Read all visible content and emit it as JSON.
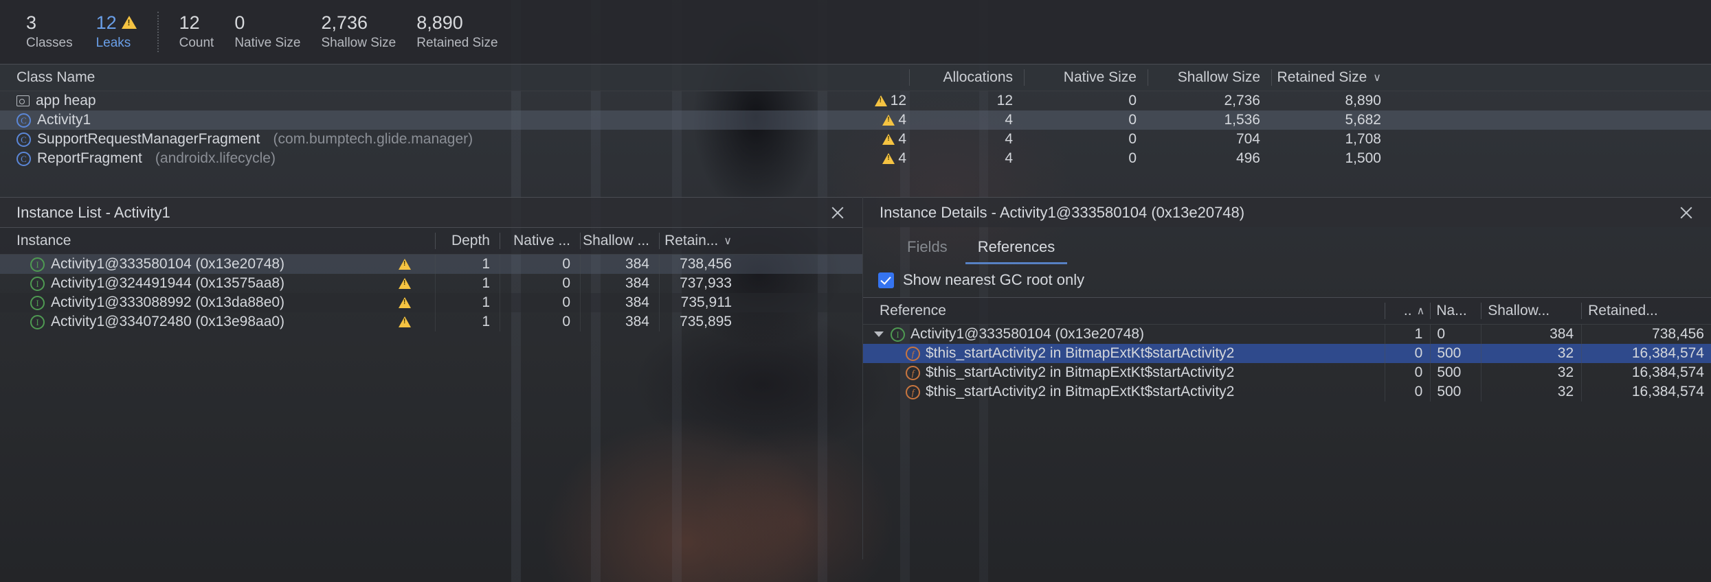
{
  "summary": {
    "stats": [
      {
        "value": "3",
        "label": "Classes",
        "warn": false
      },
      {
        "value": "12",
        "label": "Leaks",
        "warn": true
      },
      {
        "value": "12",
        "label": "Count",
        "warn": false
      },
      {
        "value": "0",
        "label": "Native Size",
        "warn": false
      },
      {
        "value": "2,736",
        "label": "Shallow Size",
        "warn": false
      },
      {
        "value": "8,890",
        "label": "Retained Size",
        "warn": false
      }
    ]
  },
  "class_table": {
    "headers": {
      "name": "Class Name",
      "leaks": "",
      "allocations": "Allocations",
      "native_size": "Native Size",
      "shallow_size": "Shallow Size",
      "retained_size": "Retained Size",
      "sort_chevron": "∨"
    },
    "rows": [
      {
        "icon": "heap-icon",
        "name": "app heap",
        "package": "",
        "leaks": "12",
        "allocations": "12",
        "native_size": "0",
        "shallow_size": "2,736",
        "retained_size": "8,890",
        "selected": false
      },
      {
        "icon": "class-icon",
        "name": "Activity1",
        "package": "",
        "leaks": "4",
        "allocations": "4",
        "native_size": "0",
        "shallow_size": "1,536",
        "retained_size": "5,682",
        "selected": true
      },
      {
        "icon": "class-icon",
        "name": "SupportRequestManagerFragment",
        "package": "(com.bumptech.glide.manager)",
        "leaks": "4",
        "allocations": "4",
        "native_size": "0",
        "shallow_size": "704",
        "retained_size": "1,708",
        "selected": false
      },
      {
        "icon": "class-icon",
        "name": "ReportFragment",
        "package": "(androidx.lifecycle)",
        "leaks": "4",
        "allocations": "4",
        "native_size": "0",
        "shallow_size": "496",
        "retained_size": "1,500",
        "selected": false
      }
    ]
  },
  "instance_list": {
    "title": "Instance List - Activity1",
    "close_label": "×",
    "headers": {
      "instance": "Instance",
      "depth": "Depth",
      "native": "Native ...",
      "shallow": "Shallow ...",
      "retained": "Retain...",
      "sort_chevron": "∨"
    },
    "rows": [
      {
        "name": "Activity1@333580104 (0x13e20748)",
        "warn": true,
        "depth": "1",
        "native": "0",
        "shallow": "384",
        "retained": "738,456",
        "selected": true
      },
      {
        "name": "Activity1@324491944 (0x13575aa8)",
        "warn": true,
        "depth": "1",
        "native": "0",
        "shallow": "384",
        "retained": "737,933",
        "selected": false
      },
      {
        "name": "Activity1@333088992 (0x13da88e0)",
        "warn": true,
        "depth": "1",
        "native": "0",
        "shallow": "384",
        "retained": "735,911",
        "selected": false
      },
      {
        "name": "Activity1@334072480 (0x13e98aa0)",
        "warn": true,
        "depth": "1",
        "native": "0",
        "shallow": "384",
        "retained": "735,895",
        "selected": false
      }
    ]
  },
  "instance_details": {
    "title": "Instance Details - Activity1@333580104 (0x13e20748)",
    "close_label": "×",
    "tabs": [
      {
        "label": "Fields",
        "active": false
      },
      {
        "label": "References",
        "active": true
      }
    ],
    "gc_root_checkbox": {
      "label": "Show nearest GC root only",
      "checked": true
    },
    "reference_table": {
      "headers": {
        "reference": "Reference",
        "depth": "..",
        "depth_sort_chevron": "∧",
        "native": "Na...",
        "shallow": "Shallow...",
        "retained": "Retained..."
      },
      "rows": [
        {
          "icon": "instance-icon",
          "expanded": true,
          "indent": 1,
          "label": "Activity1@333580104 (0x13e20748)",
          "depth": "1",
          "native": "0",
          "shallow": "384",
          "retained": "738,456",
          "selected": false
        },
        {
          "icon": "field-icon",
          "expanded": false,
          "indent": 2,
          "label": "$this_startActivity2 in BitmapExtKt$startActivity2",
          "depth": "0",
          "native": "500",
          "shallow": "32",
          "retained": "16,384,574",
          "selected": true
        },
        {
          "icon": "field-icon",
          "expanded": false,
          "indent": 2,
          "label": "$this_startActivity2 in BitmapExtKt$startActivity2",
          "depth": "0",
          "native": "500",
          "shallow": "32",
          "retained": "16,384,574",
          "selected": false
        },
        {
          "icon": "field-icon",
          "expanded": false,
          "indent": 2,
          "label": "$this_startActivity2 in BitmapExtKt$startActivity2",
          "depth": "0",
          "native": "500",
          "shallow": "32",
          "retained": "16,384,574",
          "selected": false
        }
      ]
    }
  },
  "colors": {
    "accent_blue": "#3574f0",
    "link_blue": "#6a9fe8",
    "warning_yellow": "#f5c342",
    "selection_blue": "#2f4a8c",
    "class_icon": "#5b87d8",
    "instance_icon": "#4f9a52",
    "field_icon": "#c9763f",
    "panel_bg": "#2b2d30"
  }
}
